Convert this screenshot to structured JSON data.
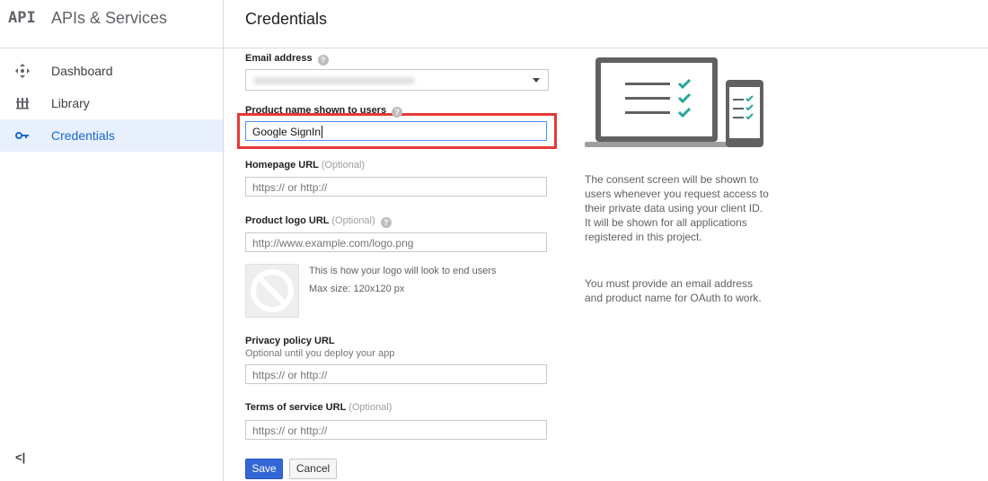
{
  "sidebar": {
    "logo_text": "API",
    "brand_title": "APIs & Services",
    "items": [
      {
        "label": "Dashboard",
        "icon": "dashboard-icon"
      },
      {
        "label": "Library",
        "icon": "library-icon"
      },
      {
        "label": "Credentials",
        "icon": "key-icon",
        "active": true
      }
    ],
    "collapse_label": "<|"
  },
  "header": {
    "title": "Credentials"
  },
  "form": {
    "email_label": "Email address",
    "product_name_label": "Product name shown to users",
    "product_name_value": "Google SignIn",
    "homepage_label": "Homepage URL",
    "homepage_optional": "(Optional)",
    "homepage_placeholder": "https:// or http://",
    "logo_label": "Product logo URL",
    "logo_optional": "(Optional)",
    "logo_placeholder": "http://www.example.com/logo.png",
    "logo_preview_text": "This is how your logo will look to end users",
    "logo_max_size": "Max size: 120x120 px",
    "privacy_label": "Privacy policy URL",
    "privacy_sublabel": "Optional until you deploy your app",
    "privacy_placeholder": "https:// or http://",
    "tos_label": "Terms of service URL",
    "tos_optional": "(Optional)",
    "tos_placeholder": "https:// or http://",
    "save_label": "Save",
    "cancel_label": "Cancel"
  },
  "info": {
    "paragraph1": "The consent screen will be shown to users whenever you request access to their private data using your client ID. It will be shown for all applications registered in this project.",
    "paragraph2": "You must provide an email address and product name for OAuth to work."
  },
  "colors": {
    "accent": "#1967d2",
    "highlight": "#e53935",
    "check": "#26a69a",
    "save_button": "#3367d6"
  }
}
